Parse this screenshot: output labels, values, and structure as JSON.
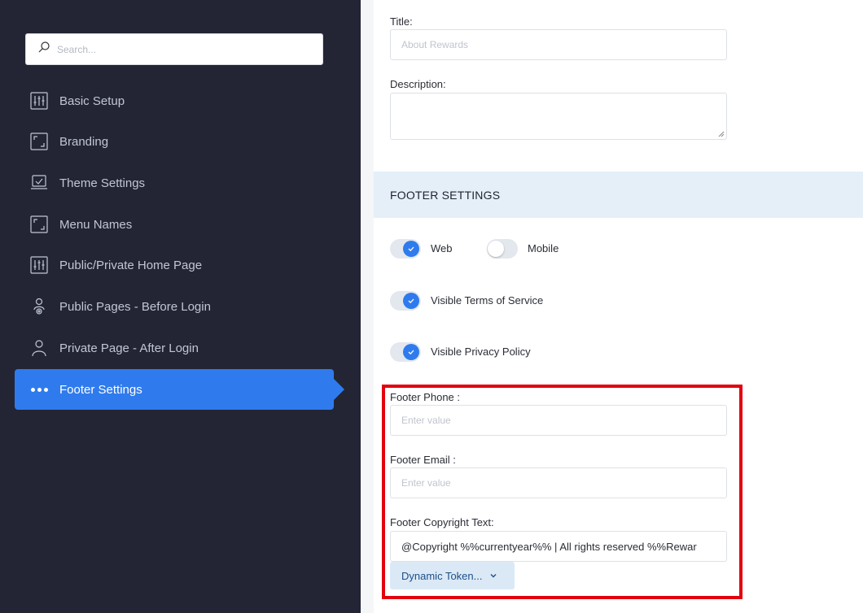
{
  "sidebar": {
    "search_placeholder": "Search...",
    "items": [
      {
        "label": "Basic Setup",
        "icon": "sliders-icon"
      },
      {
        "label": "Branding",
        "icon": "frame-icon"
      },
      {
        "label": "Theme Settings",
        "icon": "laptop-check-icon"
      },
      {
        "label": "Menu Names",
        "icon": "frame-icon"
      },
      {
        "label": "Public/Private Home Page",
        "icon": "sliders-icon"
      },
      {
        "label": "Public Pages - Before Login",
        "icon": "user-gear-icon"
      },
      {
        "label": "Private Page - After Login",
        "icon": "user-icon"
      },
      {
        "label": "Footer Settings",
        "icon": "dots-icon",
        "active": true
      }
    ]
  },
  "main": {
    "title_label": "Title:",
    "title_placeholder": "About Rewards",
    "description_label": "Description:",
    "footer_section_title": "FOOTER SETTINGS",
    "toggles": {
      "web": {
        "label": "Web",
        "on": true
      },
      "mobile": {
        "label": "Mobile",
        "on": false
      },
      "terms": {
        "label": "Visible Terms of Service",
        "on": true
      },
      "privacy": {
        "label": "Visible Privacy Policy",
        "on": true
      }
    },
    "footer_phone_label": "Footer Phone :",
    "footer_phone_placeholder": "Enter value",
    "footer_email_label": "Footer Email :",
    "footer_email_placeholder": "Enter value",
    "footer_copyright_label": "Footer Copyright Text:",
    "footer_copyright_value": "@Copyright %%currentyear%% | All rights reserved %%Rewar",
    "dynamic_token_label": "Dynamic Token..."
  },
  "colors": {
    "sidebar_bg": "#232534",
    "accent": "#2f7bed",
    "section_bg": "#e4eff8",
    "highlight_border": "#e3000f"
  }
}
